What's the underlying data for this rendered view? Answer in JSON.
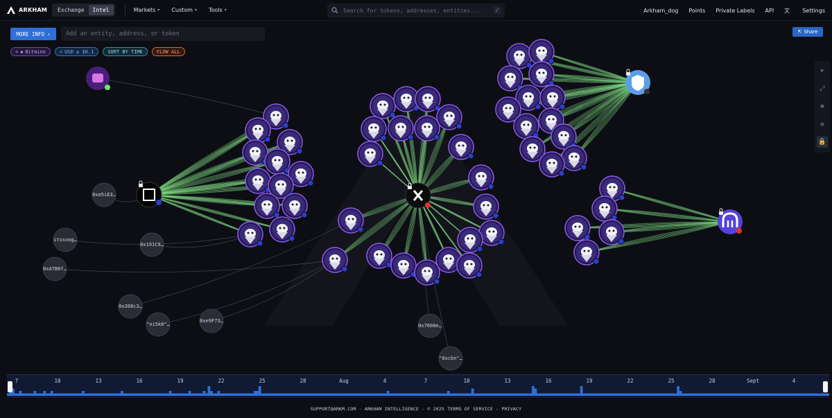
{
  "app": {
    "brand": "ARKHAM",
    "mode_tabs": [
      "Exchange",
      "Intel"
    ],
    "active_mode": "Intel",
    "nav": [
      "Markets",
      "Custom",
      "Tools"
    ],
    "search_placeholder": "Search for tokens, addresses, entities...",
    "search_shortcut": "/",
    "right_nav": [
      "Arkham_dog",
      "Points",
      "Private Labels",
      "API",
      "Settings"
    ]
  },
  "toolbar": {
    "more_info_label": "MORE INFO",
    "entity_placeholder": "Add an entity, address, or token",
    "share_label": "Share"
  },
  "filters": {
    "entity_chip": "Bitmine",
    "value_chip": "USD ≥ $0.1",
    "sort_chip": "SORT BY TIME",
    "flow_chip": "FLOW ALL"
  },
  "colors": {
    "accent_blue": "#2f6fd6",
    "flow_green": "#7fdd83",
    "node_border": "#8b5cf6",
    "background": "#0d0e14"
  },
  "graph": {
    "hub_nodes": [
      {
        "name": "okx-hub",
        "icon": "okx-logo-icon"
      },
      {
        "name": "x-hub",
        "icon": "x-logo-icon"
      },
      {
        "name": "bitgo-hub",
        "icon": "bitcoin-shield-icon"
      },
      {
        "name": "kraken-hub",
        "icon": "kraken-logo-icon"
      },
      {
        "name": "bull-entity",
        "icon": "bull-logo-icon"
      }
    ],
    "address_labels": [
      "0xe5iE3…",
      "itssoog…",
      "0x191C9…",
      "0xA7B6f…",
      "0x208c3…",
      "\"ni5k0\"…",
      "0xe9F73…",
      "0x7600e…",
      "\"0xcbn\"…"
    ]
  },
  "timeline": {
    "labels": [
      "7",
      "10",
      "13",
      "16",
      "19",
      "22",
      "25",
      "28",
      "Aug",
      "4",
      "7",
      "10",
      "13",
      "16",
      "19",
      "22",
      "25",
      "28",
      "Sept",
      "4"
    ],
    "bars": [
      1,
      2,
      3,
      1,
      1,
      2,
      1,
      1,
      1,
      1,
      1,
      2,
      1,
      1,
      1,
      2,
      1,
      1,
      2,
      1,
      1,
      1,
      1,
      1,
      1,
      1,
      1,
      1,
      1,
      1,
      1,
      2,
      1,
      1,
      1,
      1,
      1,
      1,
      1,
      1,
      1,
      1,
      1,
      1,
      1,
      1,
      1,
      2,
      1,
      1,
      1,
      1,
      1,
      1,
      1,
      1,
      1,
      1,
      1,
      1,
      1,
      1,
      1,
      1,
      1,
      1,
      1,
      2,
      1,
      1,
      1,
      1,
      1,
      1,
      1,
      2,
      1,
      1,
      1,
      1,
      1,
      2,
      1,
      4,
      2,
      1,
      1,
      2,
      1,
      1,
      1,
      1,
      1,
      1,
      1,
      1,
      1,
      1,
      1,
      1,
      1,
      1,
      2,
      2,
      4,
      1,
      1,
      1,
      1,
      1,
      1,
      1,
      1,
      1,
      1,
      1,
      1,
      1,
      1,
      1,
      1,
      1,
      1,
      1,
      1,
      1,
      1,
      1,
      1,
      1,
      1,
      1,
      1,
      1,
      1,
      1,
      1,
      1,
      1,
      1,
      1,
      1,
      1,
      1,
      1,
      1,
      1,
      1,
      1,
      1,
      1,
      1,
      1,
      1,
      1,
      1,
      1,
      2,
      1,
      1,
      1,
      1,
      1,
      1,
      1,
      1,
      1,
      1,
      1,
      1,
      1,
      1,
      1,
      1,
      1,
      1,
      1,
      1,
      1,
      1,
      1,
      1,
      2,
      1,
      1,
      1,
      1,
      1,
      1,
      1,
      1,
      1,
      3,
      1,
      1,
      1,
      1,
      1,
      1,
      1,
      1,
      1,
      1,
      1,
      1,
      1,
      1,
      1,
      1,
      1,
      1,
      1,
      1,
      1,
      1,
      1,
      1,
      4,
      3,
      1,
      1,
      1,
      1,
      1,
      1,
      1,
      1,
      1,
      1,
      1,
      1,
      1,
      1,
      1,
      1,
      1,
      1,
      4,
      1,
      1,
      1,
      1,
      1,
      1,
      1,
      1,
      1,
      1,
      1,
      1,
      1,
      1,
      1,
      1,
      1,
      1,
      1,
      1,
      1,
      1,
      1,
      1,
      1,
      1,
      1,
      1,
      1,
      1,
      1,
      1,
      1,
      1,
      1,
      1,
      1,
      1,
      1,
      4,
      2,
      1,
      1,
      1,
      1,
      1,
      1,
      1,
      1,
      1,
      1,
      1,
      1,
      1,
      1,
      1,
      1,
      1,
      1,
      1,
      1,
      1,
      1,
      1,
      1,
      1,
      1,
      1,
      1,
      1,
      1,
      1,
      1,
      1,
      1,
      1,
      1,
      1,
      1,
      1,
      1,
      1,
      1,
      1,
      1,
      1,
      1,
      1,
      1,
      1,
      1,
      1,
      1,
      1,
      1,
      1,
      1,
      1,
      1,
      1,
      1,
      1
    ]
  },
  "footer": "SUPPORT@ARKM.COM - ARKHAM INTELLIGENCE - © 2025  TERMS OF SERVICE - PRIVACY"
}
